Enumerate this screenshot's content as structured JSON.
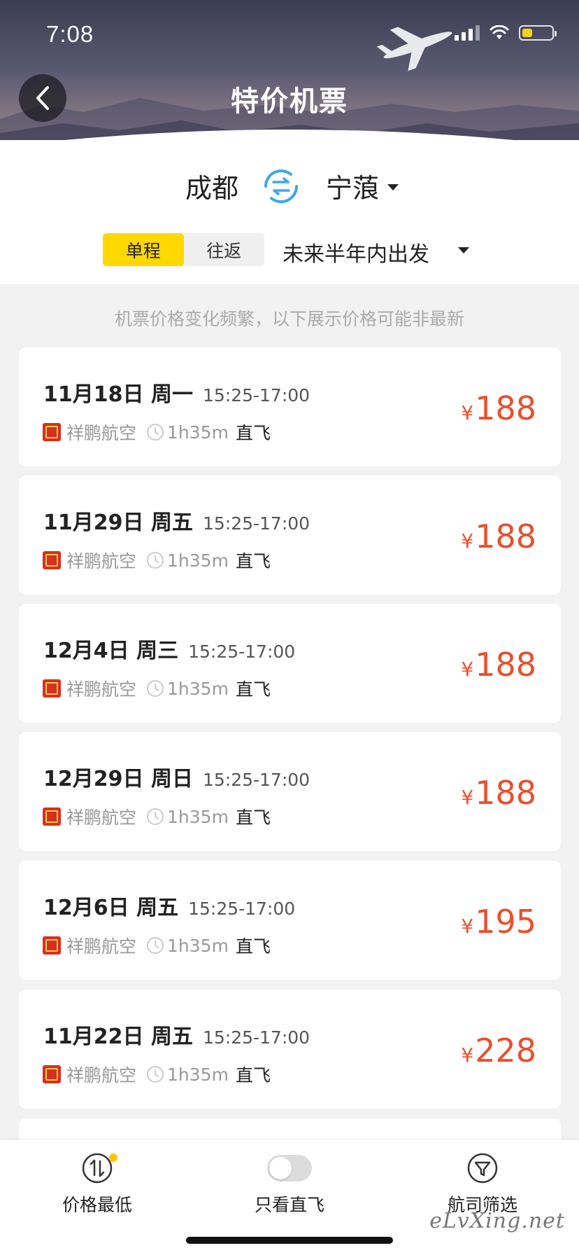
{
  "status_bar": {
    "time": "7:08"
  },
  "header": {
    "title": "特价机票",
    "back_icon": "chevron-left-icon"
  },
  "route": {
    "from": "成都",
    "to": "宁蒗",
    "swap_icon": "swap-arrows-icon"
  },
  "trip_type": {
    "options": [
      "单程",
      "往返"
    ],
    "selected": "单程"
  },
  "date_filter": {
    "label": "未来半年内出发"
  },
  "notice": "机票价格变化频繁，以下展示价格可能非最新",
  "flights": [
    {
      "date": "11月18日 周一",
      "time": "15:25-17:00",
      "airline": "祥鹏航空",
      "duration": "1h35m",
      "type": "直飞",
      "currency": "¥",
      "price": "188"
    },
    {
      "date": "11月29日 周五",
      "time": "15:25-17:00",
      "airline": "祥鹏航空",
      "duration": "1h35m",
      "type": "直飞",
      "currency": "¥",
      "price": "188"
    },
    {
      "date": "12月4日 周三",
      "time": "15:25-17:00",
      "airline": "祥鹏航空",
      "duration": "1h35m",
      "type": "直飞",
      "currency": "¥",
      "price": "188"
    },
    {
      "date": "12月29日 周日",
      "time": "15:25-17:00",
      "airline": "祥鹏航空",
      "duration": "1h35m",
      "type": "直飞",
      "currency": "¥",
      "price": "188"
    },
    {
      "date": "12月6日 周五",
      "time": "15:25-17:00",
      "airline": "祥鹏航空",
      "duration": "1h35m",
      "type": "直飞",
      "currency": "¥",
      "price": "195"
    },
    {
      "date": "11月22日 周五",
      "time": "15:25-17:00",
      "airline": "祥鹏航空",
      "duration": "1h35m",
      "type": "直飞",
      "currency": "¥",
      "price": "228"
    }
  ],
  "bottom_bar": {
    "sort_price": {
      "label": "价格最低",
      "icon": "sort-arrows-icon"
    },
    "direct_only": {
      "label": "只看直飞",
      "on": false
    },
    "airline_filter": {
      "label": "航司筛选",
      "icon": "filter-funnel-icon"
    }
  },
  "watermark": "eLvXing.net",
  "colors": {
    "accent_yellow": "#ffd800",
    "price_red": "#e8502e",
    "swap_blue": "#3ea6e8"
  }
}
